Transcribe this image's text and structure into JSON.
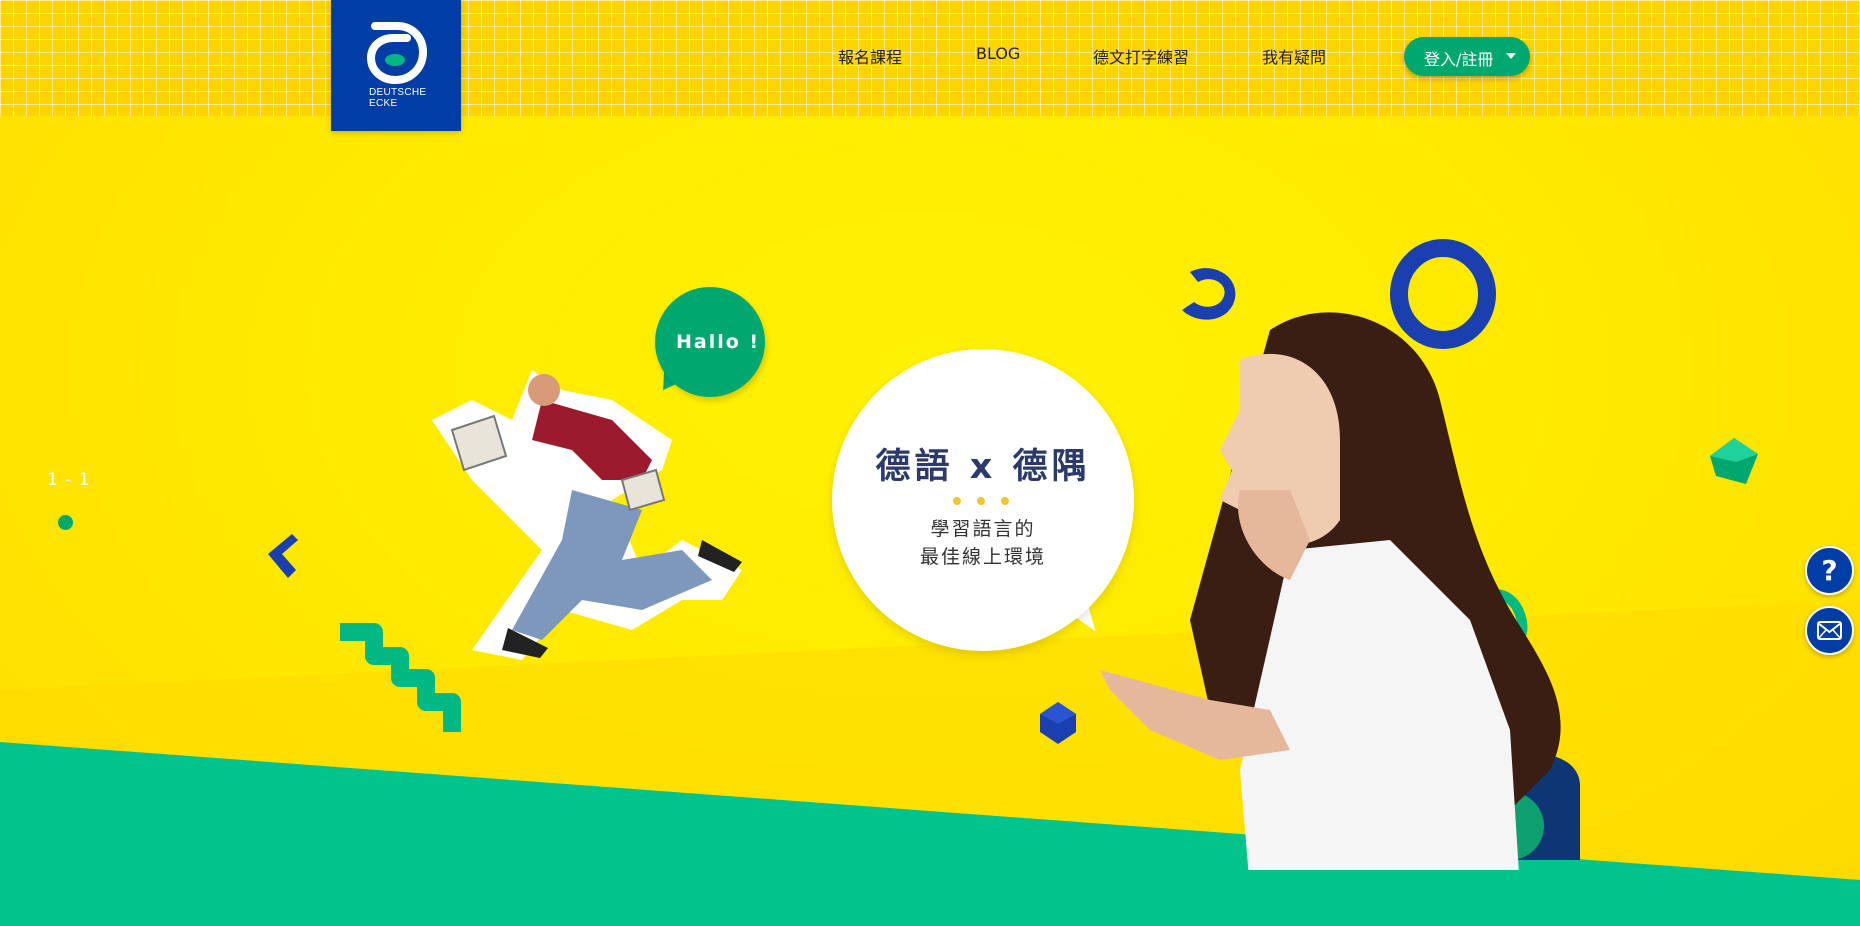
{
  "logo": {
    "line1": "DEUTSCHE",
    "line2": "ECKE"
  },
  "nav": {
    "items": [
      "報名課程",
      "BLOG",
      "德文打字練習",
      "我有疑問"
    ],
    "login_label": "登入/註冊"
  },
  "hero": {
    "counter": "1 - 1",
    "hallo": "Hallo !",
    "title": "德語 x 德隅",
    "subtitle_line1": "學習語言的",
    "subtitle_line2": "最佳線上環境"
  },
  "side_buttons": {
    "help_glyph": "?"
  },
  "colors": {
    "yellow": "#ffe600",
    "green": "#00c48c",
    "brand_blue": "#003da5",
    "accent_green": "#00a870"
  },
  "icons": [
    "logo-mark",
    "caret-down-icon",
    "question-icon",
    "mail-icon"
  ]
}
